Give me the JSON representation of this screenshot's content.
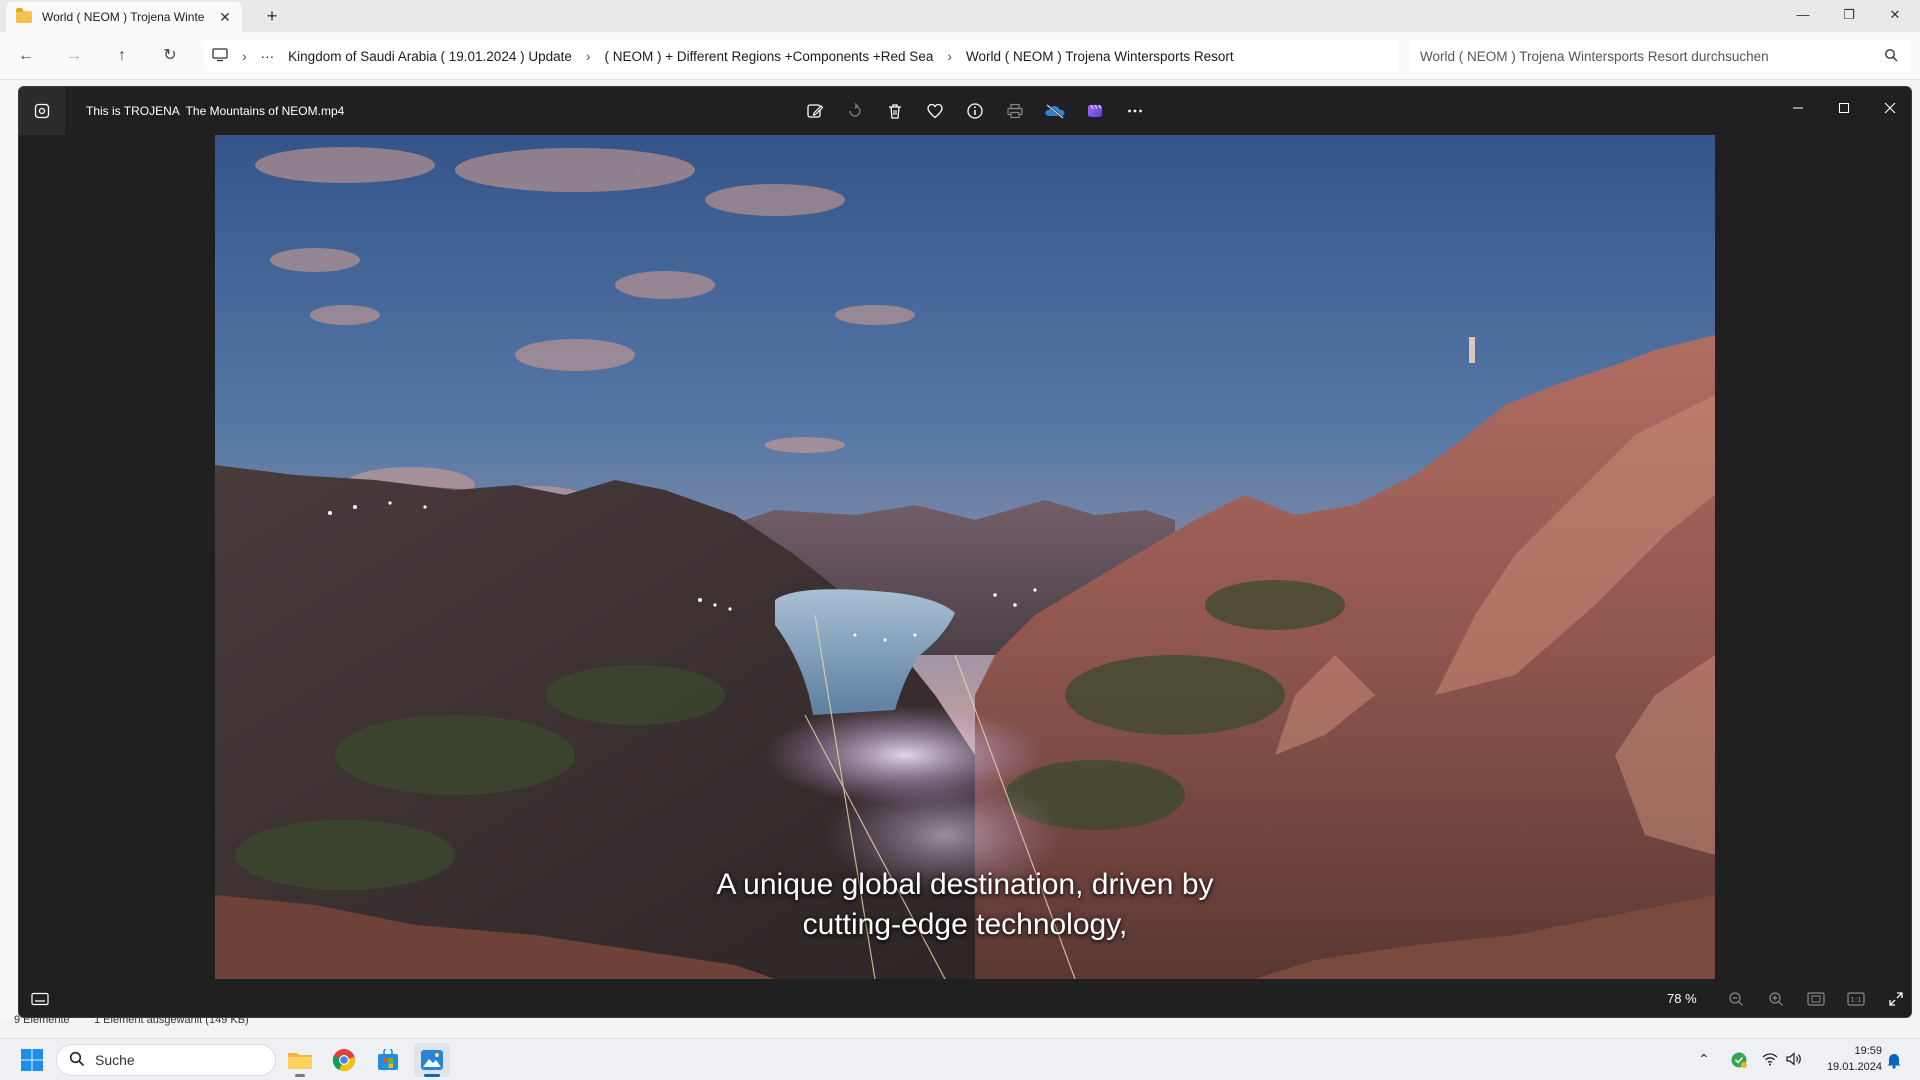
{
  "explorer": {
    "tab_title": "World ( NEOM ) Trojena Winte",
    "breadcrumbs": [
      "Kingdom of Saudi Arabia ( 19.01.2024 ) Update",
      "( NEOM ) + Different Regions +Components +Red Sea",
      "World ( NEOM ) Trojena Wintersports Resort"
    ],
    "search_placeholder": "World ( NEOM ) Trojena Wintersports Resort durchsuchen",
    "status_items": "9 Elemente",
    "status_selected": "1 Element ausgewählt (149 KB)"
  },
  "viewer": {
    "title": "This is TROJENA  The Mountains of NEOM.mp4",
    "toolbar_icons": [
      "edit-icon",
      "rotate-icon",
      "delete-icon",
      "favorite-icon",
      "info-icon",
      "print-icon",
      "onedrive-icon",
      "clipchamp-icon",
      "more-icon"
    ],
    "caption_line1": "A unique global destination, driven by",
    "caption_line2": "cutting-edge technology,",
    "zoom": "78 %"
  },
  "taskbar": {
    "search_label": "Suche",
    "time": "19:59",
    "date": "19.01.2024"
  },
  "colors": {
    "viewer_bg": "#202020",
    "accent": "#0067c0",
    "folder": "#f6c24a"
  }
}
